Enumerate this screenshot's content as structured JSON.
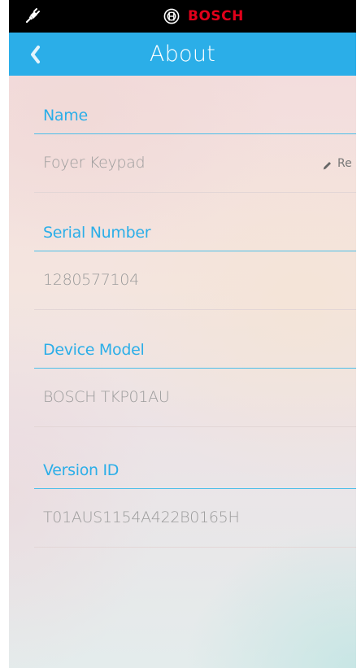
{
  "status_bar": {
    "plug_icon": "plug-icon",
    "brand_icon": "bosch-logo-icon",
    "brand_name": "BOSCH",
    "brand_color": "#e2001a"
  },
  "header": {
    "title": "About",
    "back_icon": "chevron-left-icon",
    "background_color": "#2baee8"
  },
  "sections": {
    "name": {
      "label": "Name",
      "value": "Foyer Keypad",
      "action_icon": "pencil-icon",
      "action_label": "Re"
    },
    "serial_number": {
      "label": "Serial Number",
      "value": "1280577104"
    },
    "device_model": {
      "label": "Device Model",
      "value": "BOSCH TKP01AU"
    },
    "version_id": {
      "label": "Version ID",
      "value": "T01AUS1154A422B0165H"
    }
  }
}
